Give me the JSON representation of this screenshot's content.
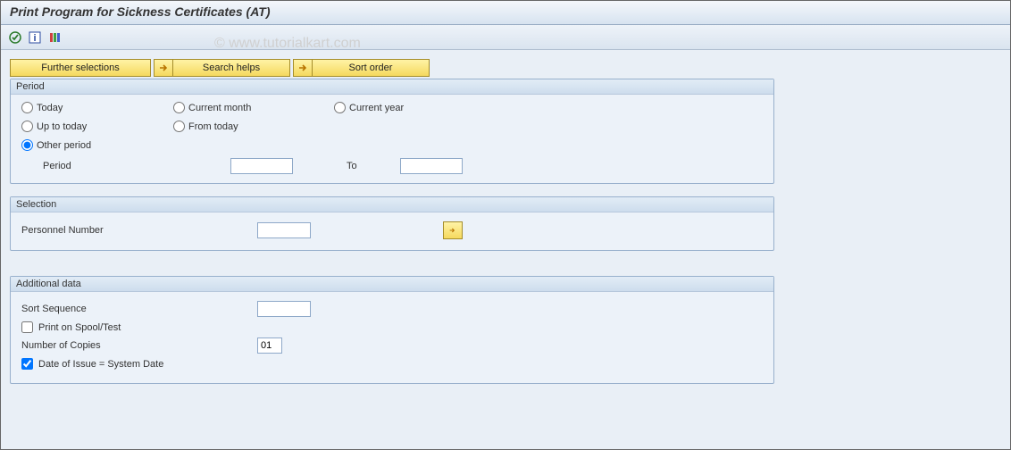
{
  "title": "Print Program for Sickness Certificates (AT)",
  "watermark": "© www.tutorialkart.com",
  "buttons": {
    "further_selections": "Further selections",
    "search_helps": "Search helps",
    "sort_order": "Sort order"
  },
  "period": {
    "title": "Period",
    "today": "Today",
    "current_month": "Current month",
    "current_year": "Current year",
    "up_to_today": "Up to today",
    "from_today": "From today",
    "other_period": "Other period",
    "period_label": "Period",
    "to_label": "To",
    "period_from": "",
    "period_to": "",
    "selected": "other_period"
  },
  "selection": {
    "title": "Selection",
    "personnel_number_label": "Personnel Number",
    "personnel_number": ""
  },
  "additional": {
    "title": "Additional data",
    "sort_sequence_label": "Sort Sequence",
    "sort_sequence": "",
    "print_spool_label": "Print on Spool/Test",
    "print_spool_checked": false,
    "copies_label": "Number of Copies",
    "copies_value": "01",
    "date_issue_label": "Date of Issue = System Date",
    "date_issue_checked": true
  }
}
